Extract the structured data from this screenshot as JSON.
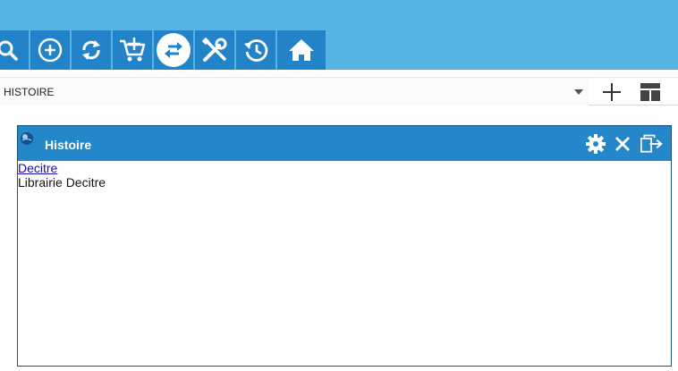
{
  "toolbar": {
    "buttons": [
      {
        "name": "search-icon"
      },
      {
        "name": "add-circle-icon"
      },
      {
        "name": "refresh-icon"
      },
      {
        "name": "cart-add-icon"
      },
      {
        "name": "swap-icon",
        "active": true
      },
      {
        "name": "tools-icon"
      },
      {
        "name": "history-icon"
      },
      {
        "name": "home-icon"
      }
    ]
  },
  "selector": {
    "value": "HISTOIRE",
    "add_icon": "plus-icon",
    "layout_icon": "layout-icon"
  },
  "widget": {
    "title": "Histoire",
    "link_text": "Decitre",
    "description": "Librairie Decitre",
    "icons": [
      "globe-icon",
      "gear-icon",
      "close-icon",
      "popout-icon"
    ]
  },
  "colors": {
    "top_band": "#56b3e3",
    "button_bg": "#2383c8",
    "header_bg": "#2387c9"
  }
}
